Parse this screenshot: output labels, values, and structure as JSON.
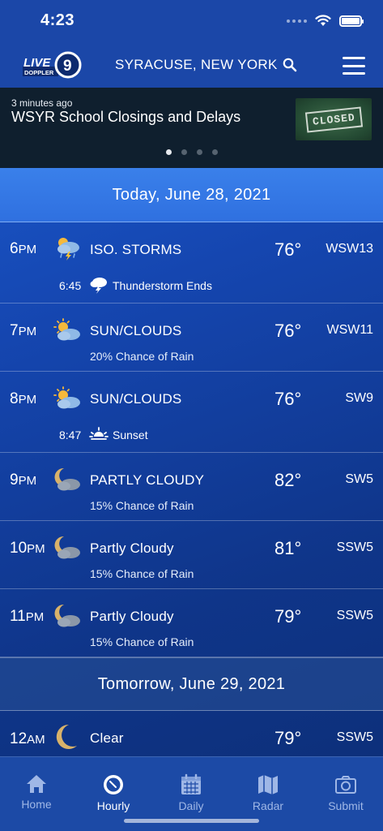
{
  "status_bar": {
    "time": "4:23"
  },
  "header": {
    "logo_text_top": "LIVE",
    "logo_text_bottom": "DOPPLER",
    "logo_number": "9",
    "location": "SYRACUSE, NEW YORK"
  },
  "banner": {
    "age": "3 minutes ago",
    "title": "WSYR School Closings and Delays",
    "thumb_text": "CLOSED",
    "page_count": 4,
    "active_page": 1
  },
  "days": [
    {
      "label": "Today, June 28, 2021"
    },
    {
      "label": "Tomorrow, June 29, 2021"
    }
  ],
  "hours": [
    {
      "hour": "6",
      "period": "PM",
      "icon": "storm-icon",
      "condition": "ISO. STORMS",
      "temp": "76°",
      "wind": "WSW13",
      "event": {
        "time": "6:45",
        "icon": "thunderstorm-icon",
        "label": "Thunderstorm Ends"
      }
    },
    {
      "hour": "7",
      "period": "PM",
      "icon": "sun-clouds-icon",
      "condition": "SUN/CLOUDS",
      "temp": "76°",
      "wind": "WSW11",
      "detail": "20% Chance of Rain"
    },
    {
      "hour": "8",
      "period": "PM",
      "icon": "sun-clouds-icon",
      "condition": "SUN/CLOUDS",
      "temp": "76°",
      "wind": "SW9",
      "event": {
        "time": "8:47",
        "icon": "sunset-icon",
        "label": "Sunset"
      }
    },
    {
      "hour": "9",
      "period": "PM",
      "icon": "moon-cloud-icon",
      "condition": "PARTLY CLOUDY",
      "temp": "82°",
      "wind": "SW5",
      "detail": "15% Chance of Rain"
    },
    {
      "hour": "10",
      "period": "PM",
      "icon": "moon-cloud-icon",
      "condition": "Partly Cloudy",
      "temp": "81°",
      "wind": "SSW5",
      "detail": "15% Chance of Rain"
    },
    {
      "hour": "11",
      "period": "PM",
      "icon": "moon-cloud-icon",
      "condition": "Partly Cloudy",
      "temp": "79°",
      "wind": "SSW5",
      "detail": "15% Chance of Rain"
    },
    {
      "hour": "12",
      "period": "AM",
      "icon": "moon-icon",
      "condition": "Clear",
      "temp": "79°",
      "wind": "SSW5"
    }
  ],
  "tabs": [
    {
      "label": "Home",
      "icon": "house-icon"
    },
    {
      "label": "Hourly",
      "icon": "clock-icon",
      "active": true
    },
    {
      "label": "Daily",
      "icon": "calendar-icon"
    },
    {
      "label": "Radar",
      "icon": "map-icon"
    },
    {
      "label": "Submit",
      "icon": "camera-icon"
    }
  ],
  "colors": {
    "header_blue": "#1b47a8",
    "today_header": "#3a80ea",
    "banner_bg": "#0f1f2e",
    "tab_inactive": "#9fb7e6"
  }
}
